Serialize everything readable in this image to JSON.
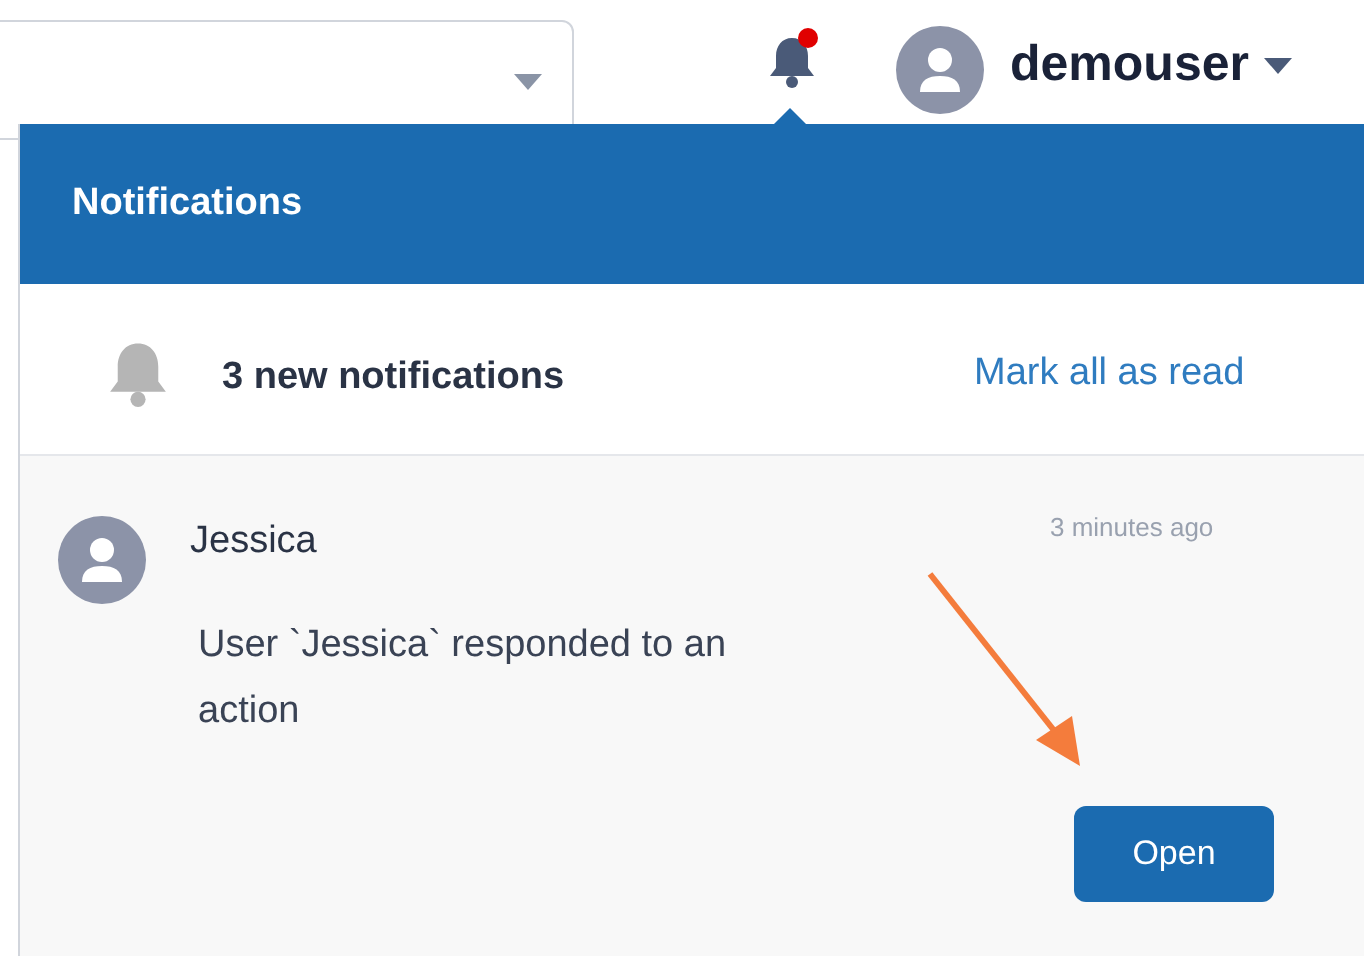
{
  "topbar": {
    "bell_unread": true,
    "username": "demouser"
  },
  "panel": {
    "title": "Notifications",
    "summary": "3 new notifications",
    "mark_all": "Mark all as read",
    "items": [
      {
        "sender": "Jessica",
        "time": "3 minutes ago",
        "message": "User `Jessica` responded to an action",
        "action": "Open"
      }
    ]
  }
}
